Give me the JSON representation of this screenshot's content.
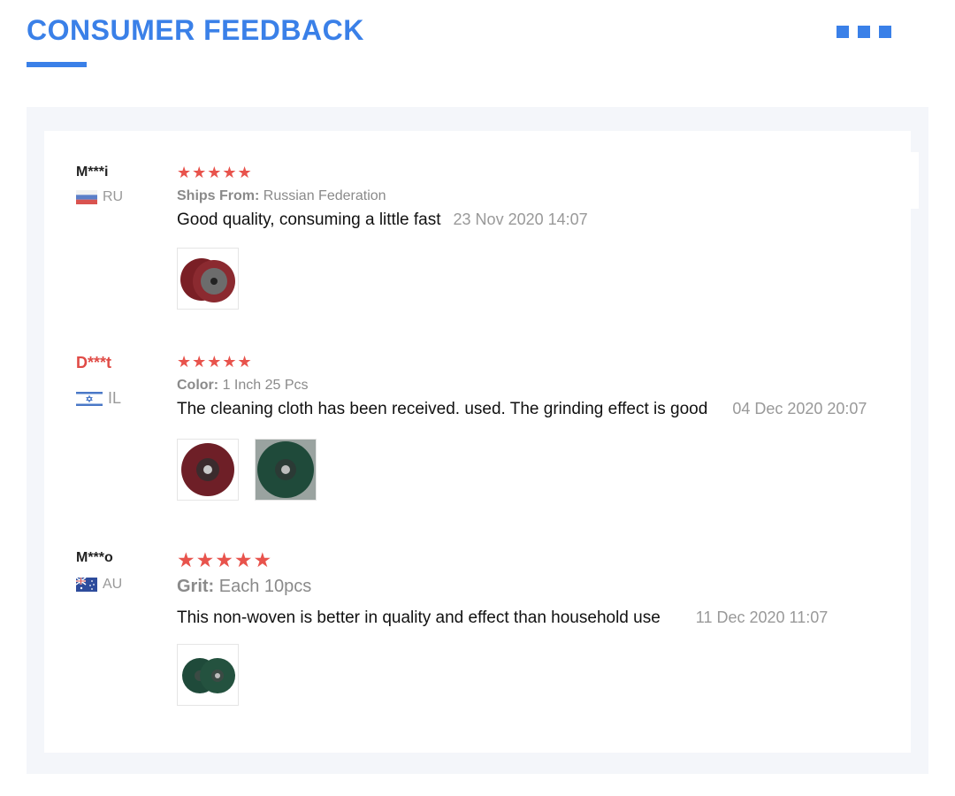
{
  "header": {
    "title": "CONSUMER FEEDBACK",
    "menu_icon": "more-squares-icon",
    "accent_color": "#3a80e8"
  },
  "reviews": [
    {
      "name": "M***i",
      "country": "RU",
      "flag_icon": "russia-flag-icon",
      "stars": "★★★★★",
      "rating": 5,
      "meta_key": "Ships From:",
      "meta_value": "Russian Federation",
      "comment": "Good quality, consuming a little fast",
      "date": "23 Nov 2020 14:07",
      "photos": [
        "maroon-flap-disc-pair"
      ]
    },
    {
      "name": "D***t",
      "country": "IL",
      "flag_icon": "israel-flag-icon",
      "stars": "★★★★★",
      "rating": 5,
      "meta_key": "Color:",
      "meta_value": "1 Inch 25 Pcs",
      "comment": "The cleaning cloth has been received.  used. The grinding effect is good",
      "date": "04 Dec 2020 20:07",
      "photos": [
        "maroon-flap-disc",
        "green-flap-disc"
      ]
    },
    {
      "name": "M***o",
      "country": "AU",
      "flag_icon": "australia-flag-icon",
      "stars": "★★★★★",
      "rating": 5,
      "meta_key": "Grit:",
      "meta_value": "Each 10pcs",
      "comment": "This non-woven is better in quality and effect than household use",
      "date": "11 Dec 2020 11:07",
      "photos": [
        "green-flap-disc-pair"
      ]
    }
  ],
  "colors": {
    "star": "#e8534c",
    "highlight_name": "#e04b46",
    "muted_text": "#999999"
  }
}
